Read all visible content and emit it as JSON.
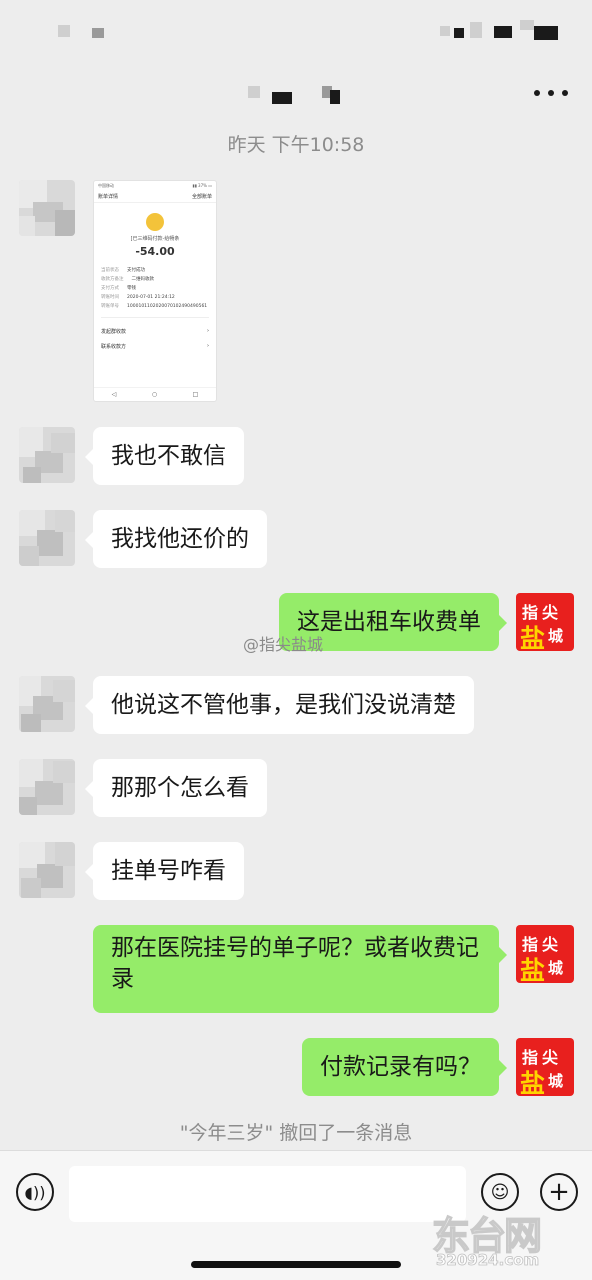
{
  "header": {
    "timestamp": "昨天 下午10:58"
  },
  "receipt": {
    "nav_title": "账单详情",
    "nav_right": "全部账单",
    "merchant": "[已三维码付款-给畅条",
    "amount": "-54.00",
    "rows": [
      {
        "k": "当前状态",
        "v": "支付成功"
      },
      {
        "k": "收款方备注",
        "v": "二维码收款"
      },
      {
        "k": "支付方式",
        "v": "零钱"
      },
      {
        "k": "转账时间",
        "v": "2020-07-01 21:24:12"
      },
      {
        "k": "转账单号",
        "v": "1000101102020070102490490561"
      }
    ],
    "link1": "发起群收款",
    "link2": "联系收款方",
    "navbar": [
      "◁",
      "○",
      "□"
    ]
  },
  "messages": [
    {
      "side": "in",
      "text": "我也不敢信"
    },
    {
      "side": "in",
      "text": "我找他还价的"
    },
    {
      "side": "out",
      "text": "这是出租车收费单"
    },
    {
      "side": "in",
      "text": "他说这不管他事，是我们没说清楚"
    },
    {
      "side": "in",
      "text": "那那个怎么看"
    },
    {
      "side": "in",
      "text": "挂单号咋看"
    },
    {
      "side": "out",
      "text": "那在医院挂号的单子呢？或者收费记录"
    },
    {
      "side": "out",
      "text": "付款记录有吗？"
    }
  ],
  "watermark": "@指尖盐城",
  "logo_avatar": {
    "line1": "指尖",
    "line2": "盐",
    "line3": "城"
  },
  "recall_notice": "\"今年三岁\" 撤回了一条消息",
  "input_bar": {
    "voice_icon": "voice-icon",
    "emoji_icon": "emoji-icon",
    "plus_icon": "plus-icon"
  },
  "site_logo": {
    "main": "东台网",
    "url": "320924.com"
  }
}
